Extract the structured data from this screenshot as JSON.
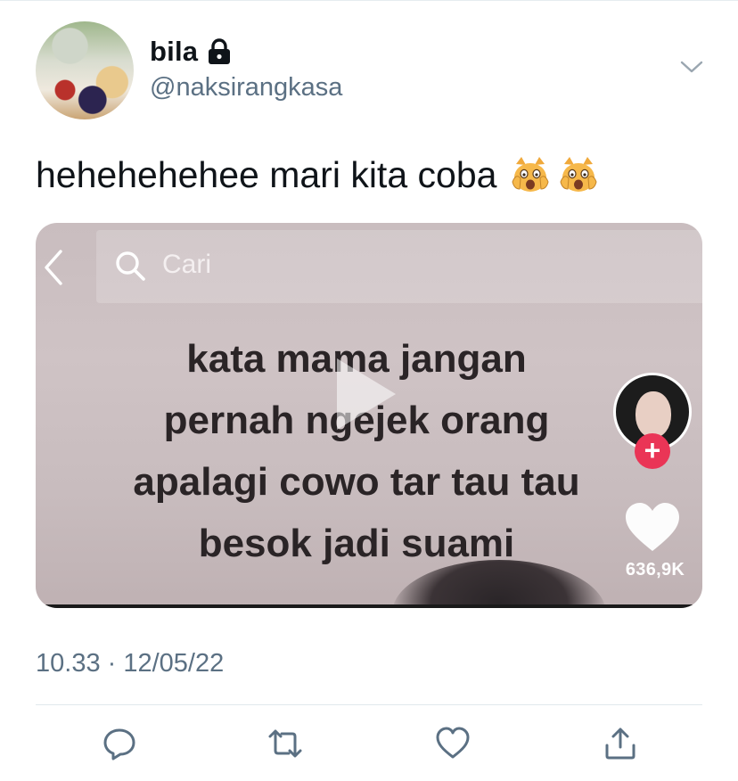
{
  "tweet": {
    "author": {
      "name": "bila",
      "handle": "@naksirangkasa",
      "protected_icon": "lock-icon",
      "avatar": "avatar"
    },
    "menu_icon": "chevron-down-icon",
    "text": "hehehehehee mari kita coba",
    "emojis": [
      "weary-cat-face-emoji",
      "weary-cat-face-emoji"
    ],
    "timestamp": "10.33 · 12/05/22"
  },
  "media": {
    "back_icon": "chevron-left-icon",
    "search_icon": "search-icon",
    "search_text": "Cari",
    "overlay_lines": [
      "kata mama jangan",
      "pernah ngejek orang",
      "apalagi cowo tar tau tau",
      "besok jadi suami"
    ],
    "play_icon": "play-icon",
    "follow_label": "+",
    "like_icon": "heart-icon",
    "like_count": "636,9K"
  },
  "actions": [
    {
      "name": "reply",
      "icon": "reply-icon"
    },
    {
      "name": "retweet",
      "icon": "retweet-icon"
    },
    {
      "name": "like",
      "icon": "heart-outline-icon"
    },
    {
      "name": "share",
      "icon": "share-icon"
    }
  ],
  "colors": {
    "text_primary": "#0f1419",
    "text_secondary": "#5b7083",
    "icon": "#5b7083",
    "follow_badge": "#ea3556"
  }
}
